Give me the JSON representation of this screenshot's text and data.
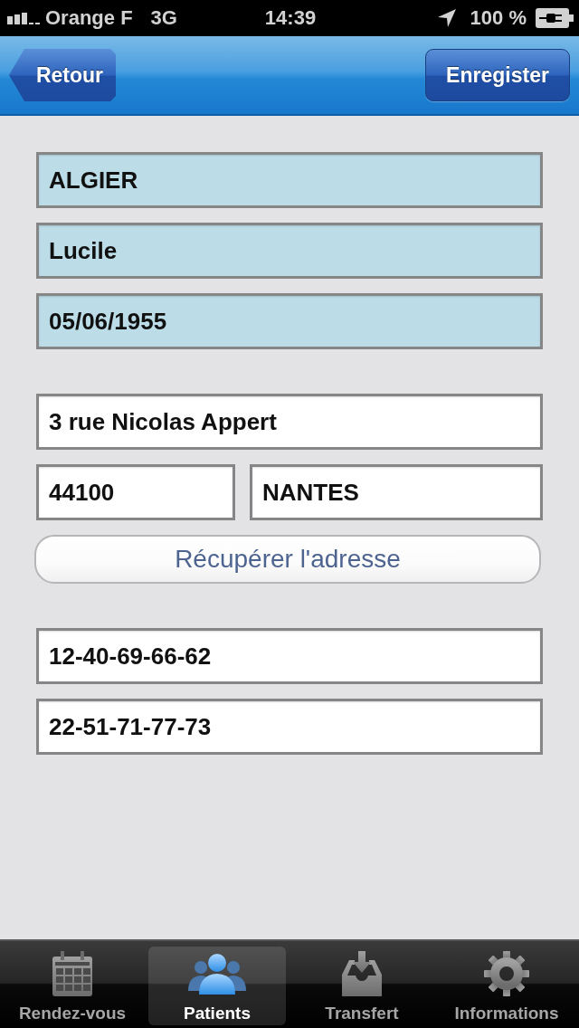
{
  "status_bar": {
    "carrier": "Orange F",
    "network": "3G",
    "time": "14:39",
    "battery": "100 %"
  },
  "nav_bar": {
    "back_button": "Retour",
    "save_button": "Enregister"
  },
  "form": {
    "sections": [
      {
        "items": [
          {
            "kind": "fields",
            "fields": [
              {
                "value": "ALGIER",
                "kind": "tinted"
              }
            ]
          },
          {
            "kind": "fields",
            "fields": [
              {
                "value": "Lucile",
                "kind": "tinted"
              }
            ]
          },
          {
            "kind": "fields",
            "fields": [
              {
                "value": "05/06/1955",
                "kind": "tinted"
              }
            ]
          }
        ]
      },
      {
        "items": [
          {
            "kind": "fields",
            "fields": [
              {
                "value": "3 rue Nicolas Appert",
                "kind": "plain"
              }
            ]
          },
          {
            "kind": "fields",
            "fields": [
              {
                "value": "44100",
                "kind": "plain"
              },
              {
                "value": "NANTES",
                "kind": "plain"
              }
            ]
          },
          {
            "kind": "button",
            "label": "Récupérer l'adresse"
          }
        ]
      },
      {
        "items": [
          {
            "kind": "fields",
            "fields": [
              {
                "value": "12-40-69-66-62",
                "kind": "plain"
              }
            ]
          },
          {
            "kind": "fields",
            "fields": [
              {
                "value": "22-51-71-77-73",
                "kind": "plain"
              }
            ]
          }
        ]
      }
    ]
  },
  "tab_bar": {
    "tabs": [
      {
        "label": "Rendez-vous",
        "selected": false
      },
      {
        "label": "Patients",
        "selected": true
      },
      {
        "label": "Transfert",
        "selected": false
      },
      {
        "label": "Informations",
        "selected": false
      }
    ]
  }
}
